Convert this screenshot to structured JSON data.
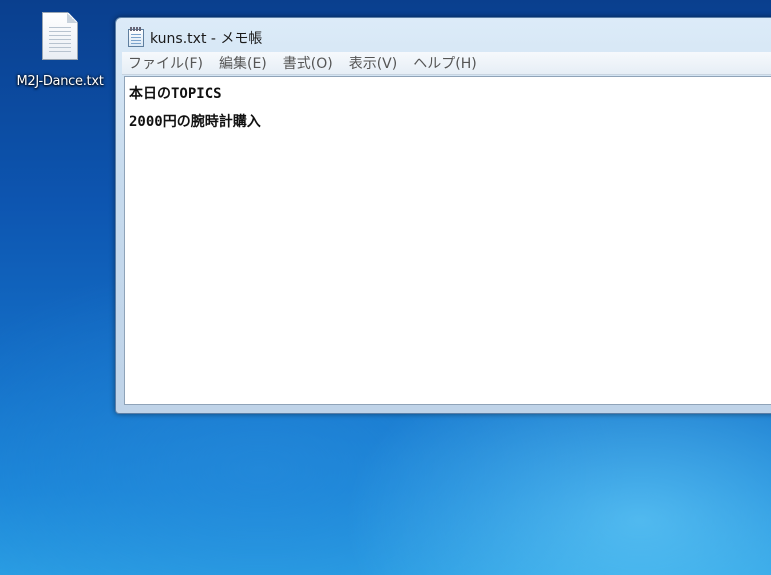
{
  "desktop": {
    "icons": [
      {
        "label": "M2J-Dance.txt",
        "icon": "text-file-icon"
      }
    ]
  },
  "window": {
    "title": "kuns.txt - メモ帳",
    "icon": "notepad-icon",
    "menu": [
      {
        "label": "ファイル(F)"
      },
      {
        "label": "編集(E)"
      },
      {
        "label": "書式(O)"
      },
      {
        "label": "表示(V)"
      },
      {
        "label": "ヘルプ(H)"
      }
    ],
    "content_lines": [
      "本日のTOPICS",
      "2000円の腕時計購入"
    ]
  },
  "colors": {
    "desktop_top": "#0a3f8e",
    "desktop_bottom": "#2a9ee3",
    "window_frame": "#c7dbee"
  }
}
